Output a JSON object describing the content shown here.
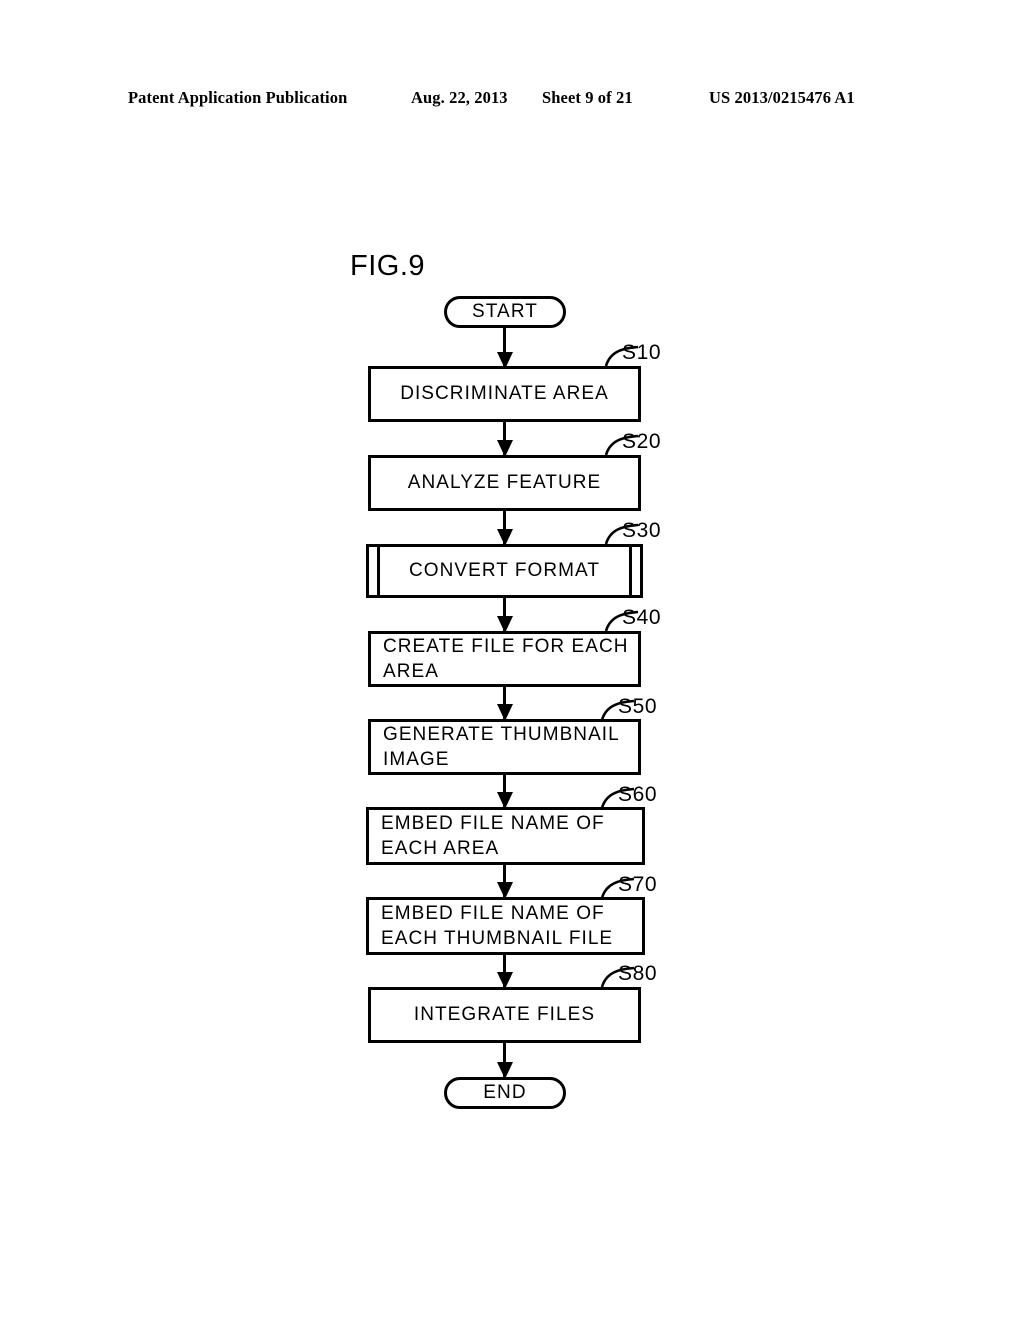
{
  "header": {
    "publication": "Patent Application Publication",
    "date": "Aug. 22, 2013",
    "sheet": "Sheet 9 of 21",
    "number": "US 2013/0215476 A1"
  },
  "figure": {
    "title": "FIG.9",
    "start_label": "START",
    "end_label": "END",
    "steps": [
      {
        "ref": "S10",
        "text": "DISCRIMINATE AREA",
        "shape": "process",
        "align": "center"
      },
      {
        "ref": "S20",
        "text": "ANALYZE FEATURE",
        "shape": "process",
        "align": "center"
      },
      {
        "ref": "S30",
        "text": "CONVERT FORMAT",
        "shape": "predefined-process",
        "align": "center"
      },
      {
        "ref": "S40",
        "text": "CREATE FILE FOR EACH AREA",
        "shape": "process",
        "align": "left"
      },
      {
        "ref": "S50",
        "text": "GENERATE THUMBNAIL IMAGE",
        "shape": "process",
        "align": "left"
      },
      {
        "ref": "S60",
        "text": "EMBED FILE NAME OF EACH AREA",
        "shape": "process",
        "align": "left"
      },
      {
        "ref": "S70",
        "text": "EMBED FILE NAME OF EACH THUMBNAIL FILE",
        "shape": "process",
        "align": "left"
      },
      {
        "ref": "S80",
        "text": "INTEGRATE FILES",
        "shape": "process",
        "align": "center"
      }
    ]
  },
  "colors": {
    "ink": "#000000",
    "paper": "#ffffff"
  }
}
